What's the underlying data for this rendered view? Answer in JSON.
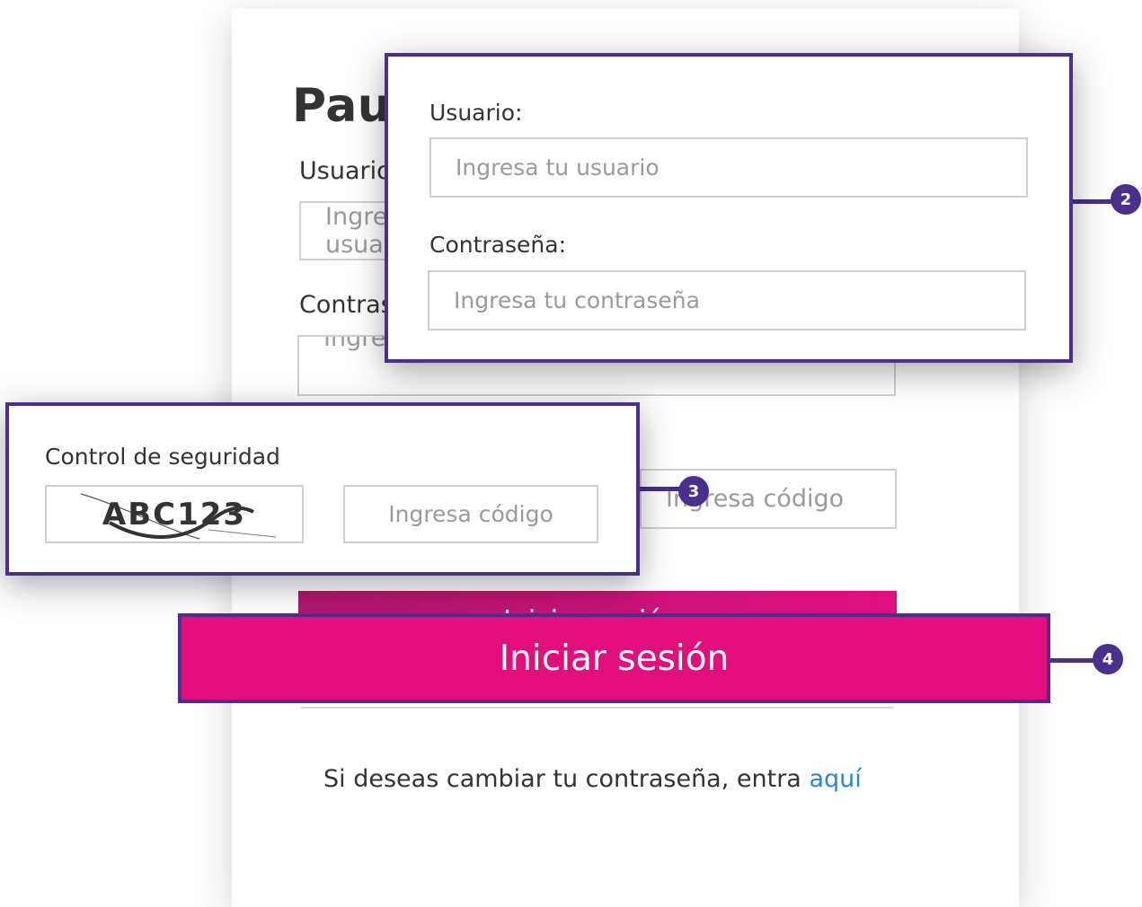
{
  "colors": {
    "accent": "#e20e7c",
    "callout_border": "#4b2f8c",
    "link": "#2a86d1"
  },
  "login": {
    "title": "Pau",
    "user_label": "Usuario:",
    "user_placeholder": "Ingresa tu usuario",
    "password_label": "Contraseña:",
    "password_placeholder": "Ingresa tu contraseña",
    "code_placeholder": "Ingresa código",
    "submit_label": "Iniciar sesión"
  },
  "security": {
    "label": "Control de seguridad",
    "captcha_text": "ABC123",
    "code_placeholder": "Ingresa código"
  },
  "badges": {
    "credentials": "2",
    "security": "3",
    "submit": "4"
  },
  "footer": {
    "text": "Si deseas cambiar tu contraseña, entra",
    "link": "aquí"
  }
}
